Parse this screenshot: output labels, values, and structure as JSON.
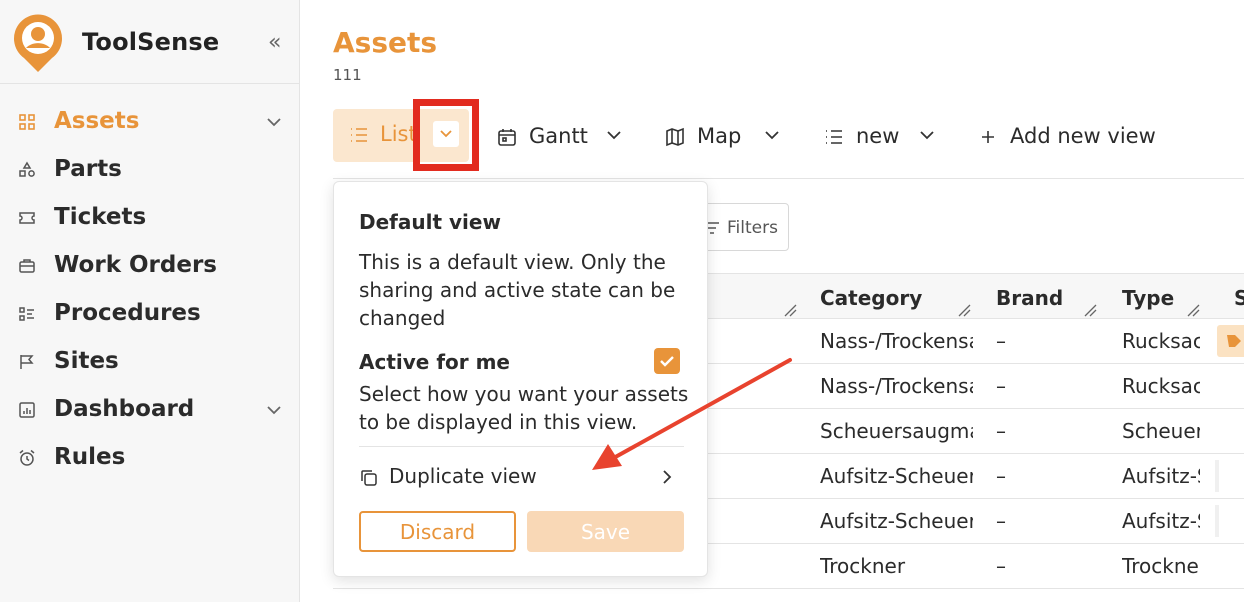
{
  "app": {
    "name": "ToolSense",
    "collapse_glyph": "«"
  },
  "sidebar": {
    "items": [
      {
        "label": "Assets",
        "icon": "grid-icon",
        "active": true,
        "has_children": true
      },
      {
        "label": "Parts",
        "icon": "shapes-icon",
        "active": false,
        "has_children": false
      },
      {
        "label": "Tickets",
        "icon": "ticket-icon",
        "active": false,
        "has_children": false
      },
      {
        "label": "Work Orders",
        "icon": "briefcase-icon",
        "active": false,
        "has_children": false
      },
      {
        "label": "Procedures",
        "icon": "checklist-icon",
        "active": false,
        "has_children": false
      },
      {
        "label": "Sites",
        "icon": "flag-icon",
        "active": false,
        "has_children": false
      },
      {
        "label": "Dashboard",
        "icon": "chart-icon",
        "active": false,
        "has_children": true
      },
      {
        "label": "Rules",
        "icon": "alarm-icon",
        "active": false,
        "has_children": false
      }
    ]
  },
  "header": {
    "title": "Assets",
    "count": "111"
  },
  "views": {
    "list": "List",
    "gantt": "Gantt",
    "map": "Map",
    "new": "new",
    "add": "Add new view"
  },
  "toolbar": {
    "filters": "Filters"
  },
  "table": {
    "columns": [
      "Category",
      "Brand",
      "Type",
      "S"
    ],
    "rows": [
      [
        "Nass-/Trockensauger",
        "–",
        "Rucksacksauger"
      ],
      [
        "Nass-/Trockensauger",
        "–",
        "Rucksacksauger"
      ],
      [
        "Scheuersaugmaschine",
        "–",
        "Scheuersaugmaschine"
      ],
      [
        "Aufsitz-Scheuersaugmaschine",
        "–",
        "Aufsitz-Scheuersaugmaschine"
      ],
      [
        "Aufsitz-Scheuersaugmaschine",
        "–",
        "Aufsitz-Scheuersaugmaschine"
      ],
      [
        "Trockner",
        "–",
        "Trockner"
      ]
    ]
  },
  "popover": {
    "title": "Default view",
    "description": "This is a default view. Only the sharing and active state can be changed",
    "active_label": "Active for me",
    "active_checked": true,
    "select_text": "Select how you want your assets to be displayed in this view.",
    "duplicate": "Duplicate view",
    "discard": "Discard",
    "save": "Save"
  },
  "colors": {
    "accent": "#e8943a",
    "highlight": "#e22b1f",
    "accent_light": "#fbe7cf"
  }
}
